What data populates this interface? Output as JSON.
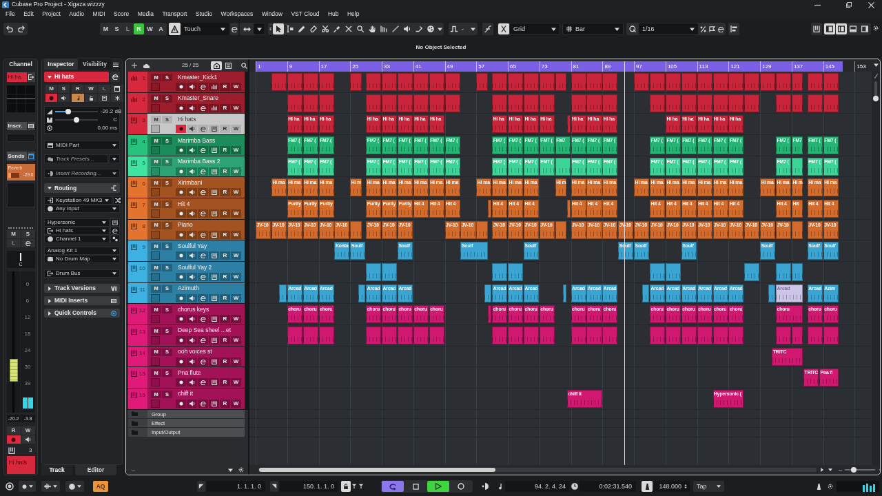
{
  "window": {
    "title": "Cubase Pro Project - Xigaza wizzzy"
  },
  "menu": [
    "File",
    "Edit",
    "Project",
    "Audio",
    "MIDI",
    "Score",
    "Media",
    "Transport",
    "Studio",
    "Workspaces",
    "Window",
    "VST Cloud",
    "Hub",
    "Help"
  ],
  "toolbar": {
    "automation": [
      {
        "label": "M",
        "on": false,
        "disabled": false
      },
      {
        "label": "S",
        "on": false,
        "disabled": false
      },
      {
        "label": "L",
        "on": false,
        "disabled": true
      },
      {
        "label": "R",
        "on": true,
        "disabled": false
      },
      {
        "label": "W",
        "on": false,
        "disabled": false
      },
      {
        "label": "A",
        "on": false,
        "disabled": false
      }
    ],
    "automation_panel": true,
    "automation_mode": "Touch",
    "tools": [
      {
        "kind": "pointer",
        "selected": true
      },
      {
        "kind": "range",
        "selected": false
      },
      {
        "kind": "pencil",
        "selected": false
      },
      {
        "kind": "eraser",
        "selected": false
      },
      {
        "kind": "scissors",
        "selected": false
      },
      {
        "kind": "glue",
        "selected": false
      },
      {
        "kind": "mute",
        "selected": false
      },
      {
        "kind": "zoom",
        "selected": false
      },
      {
        "kind": "hand",
        "selected": false
      },
      {
        "kind": "comp",
        "selected": false
      },
      {
        "kind": "line",
        "selected": false
      },
      {
        "kind": "speaker",
        "selected": false
      },
      {
        "kind": "warp",
        "selected": false
      }
    ],
    "nudge": "-",
    "snap": true,
    "snap_type": "Grid",
    "grid": "Bar",
    "quantize": "1/16",
    "zones": [
      {
        "kind": "left",
        "on": true
      },
      {
        "kind": "split",
        "on": true
      },
      {
        "kind": "lower",
        "on": false
      },
      {
        "kind": "right",
        "on": false
      }
    ]
  },
  "info_line": "No Object Selected",
  "channel": {
    "tab": "Channel",
    "name_tag": "Hi ha.",
    "inserts": "Inser.",
    "sends": "Sends",
    "sends_on": true,
    "send": {
      "name": "Reverb",
      "reading": "-29.0",
      "level": 0.3
    },
    "buttons": [
      {
        "label": "M",
        "disabled": false
      },
      {
        "label": "S",
        "disabled": false
      },
      {
        "label": "L",
        "disabled": true
      }
    ],
    "pan": {
      "reading": "C",
      "level": 0.5
    },
    "scale": [
      "0",
      "6",
      "12",
      "18",
      "24",
      "30",
      "39"
    ],
    "fader": {
      "level": 0.25
    },
    "readings": [
      "-20.2",
      "-3.8"
    ],
    "rw": [
      "R",
      "W"
    ],
    "record": true,
    "number": "3",
    "name": "Hi hats"
  },
  "inspector": {
    "tabs": [
      {
        "label": "Inspector",
        "selected": true
      },
      {
        "label": "Visibility",
        "selected": false
      }
    ],
    "track": {
      "name": "Hi hats",
      "expanded": true
    },
    "buttons": [
      {
        "label": "M",
        "on": false,
        "disabled": false
      },
      {
        "label": "S",
        "on": false,
        "disabled": false
      },
      {
        "label": "R",
        "on": false,
        "disabled": false
      },
      {
        "label": "W",
        "on": false,
        "disabled": false
      },
      {
        "label": "L",
        "on": false,
        "disabled": true
      }
    ],
    "toggles": [
      {
        "kind": "record",
        "on": true
      },
      {
        "kind": "monitor",
        "on": false
      },
      {
        "kind": "note",
        "on": true
      },
      {
        "kind": "lock",
        "on": false
      },
      {
        "kind": "list",
        "on": false
      },
      {
        "kind": "freeze",
        "on": false
      }
    ],
    "volume": {
      "reading": "-20.2 dB",
      "level": 0.28
    },
    "pan": {
      "reading": "C",
      "level": 0.5
    },
    "delay": "0.00 ms",
    "fields": [
      {
        "value": "MIDI Part"
      },
      {
        "placeholder": "Track Presets..."
      },
      {
        "placeholder": "Insert Recording..."
      }
    ],
    "routing": {
      "title": "Routing",
      "expanded": true,
      "groups": [
        [
          {
            "value": "Keystation 49 MK3"
          },
          {
            "value": "Any Input"
          }
        ],
        [
          {
            "value": "Hypersonic"
          },
          {
            "value": "Hi hats"
          },
          {
            "value": "Channel 1"
          }
        ],
        [
          {
            "value": "Analog Kit 1"
          },
          {
            "value": "No Drum Map"
          }
        ],
        [
          {
            "value": "Drum Bus"
          }
        ]
      ]
    },
    "sections": [
      {
        "title": "Track Versions",
        "expanded": false
      },
      {
        "title": "MIDI Inserts",
        "expanded": false
      },
      {
        "title": "Quick Controls",
        "expanded": false
      }
    ]
  },
  "lower_tabs": [
    {
      "label": "Track",
      "selected": true
    },
    {
      "label": "Editor",
      "selected": false
    }
  ],
  "track_list": {
    "count": "25 / 25"
  },
  "arrange": {
    "vertical_zoom": {
      "level": 0.05
    },
    "horizontal_zoom": {
      "level": 0.25
    }
  },
  "ruler": [
    "1",
    "9",
    "17",
    "25",
    "33",
    "41",
    "49",
    "57",
    "65",
    "73",
    "81",
    "89",
    "97",
    "105",
    "113",
    "121",
    "129",
    "137",
    "145",
    "153"
  ],
  "tracks": [
    {
      "number": "1",
      "name": "Kmaster_Kick1",
      "kind": "drum",
      "color": "#d8283e",
      "selected": false,
      "record": false,
      "buttons": [
        "M",
        "S",
        "R",
        "W"
      ],
      "clips": [
        {
          "muted": false
        },
        {
          "muted": false
        },
        {
          "muted": false
        },
        {
          "muted": false
        },
        {
          "muted": false
        },
        {
          "muted": false
        },
        {
          "muted": false
        },
        {
          "muted": false
        },
        {
          "muted": false
        },
        {
          "muted": false
        },
        {
          "muted": false
        },
        {
          "muted": false
        },
        {
          "muted": false
        },
        {
          "muted": false
        },
        {
          "muted": false
        },
        {
          "muted": false
        },
        {
          "muted": false
        },
        {
          "muted": false
        },
        {
          "muted": false
        },
        {
          "muted": false
        },
        {
          "muted": false
        },
        {
          "muted": false
        },
        {
          "muted": false
        },
        {
          "muted": false
        },
        {
          "muted": false
        },
        {
          "muted": false
        },
        {
          "muted": false
        },
        {
          "muted": false
        },
        {
          "muted": false
        },
        {
          "muted": false
        },
        {
          "muted": false
        },
        {
          "muted": false
        },
        {
          "muted": false
        }
      ]
    },
    {
      "number": "2",
      "name": "Kmaster_Snare",
      "kind": "drum",
      "color": "#d8283e",
      "selected": false,
      "record": false,
      "buttons": [
        "M",
        "S",
        "R",
        "W"
      ],
      "clips": [
        {
          "muted": false
        },
        {
          "muted": false
        },
        {
          "muted": false
        },
        {
          "muted": false
        },
        {
          "muted": false
        },
        {
          "muted": false
        },
        {
          "muted": false
        },
        {
          "muted": false
        },
        {
          "muted": false
        },
        {
          "muted": false
        },
        {
          "muted": false
        },
        {
          "muted": false
        },
        {
          "muted": false
        },
        {
          "muted": false
        },
        {
          "muted": false
        },
        {
          "muted": false
        },
        {
          "muted": false
        },
        {
          "muted": false
        },
        {
          "muted": false
        },
        {
          "muted": false
        },
        {
          "muted": false
        },
        {
          "muted": false
        },
        {
          "muted": false
        },
        {
          "muted": false
        },
        {
          "muted": false
        },
        {
          "muted": false
        },
        {
          "muted": false
        }
      ]
    },
    {
      "number": "3",
      "name": "Hi hats",
      "kind": "instrument",
      "color": "#d8283e",
      "selected": true,
      "record": true,
      "buttons": [
        "M",
        "S",
        "R",
        "W"
      ],
      "clips": [
        {
          "label": "Hi ha",
          "muted": false
        },
        {
          "label": "Hi ha",
          "muted": false
        },
        {
          "label": "Hi ha",
          "muted": false
        },
        {
          "label": "Hi ha",
          "muted": false
        },
        {
          "label": "Hi ha",
          "muted": false
        },
        {
          "label": "Hi ha",
          "muted": false
        },
        {
          "label": "Hi ha",
          "muted": false
        },
        {
          "label": "Hi ha",
          "muted": false
        },
        {
          "label": "Hi ha",
          "muted": false
        },
        {
          "label": "Hi ha",
          "muted": false
        },
        {
          "label": "Hi ha",
          "muted": false
        },
        {
          "label": "Hi ha",
          "muted": false
        },
        {
          "muted": false
        },
        {
          "label": "Hi ha",
          "muted": false
        },
        {
          "label": "Hi ha",
          "muted": false
        },
        {
          "label": "Hi ha",
          "muted": false
        },
        {
          "label": "Hi ha",
          "muted": false
        },
        {
          "label": "Hi ha",
          "muted": false
        },
        {
          "label": "Hi ha",
          "muted": false
        },
        {
          "label": "Hi ha",
          "muted": false
        },
        {
          "label": "Hi ha",
          "muted": false
        }
      ]
    },
    {
      "number": "4",
      "name": "Marimba Bass",
      "kind": "instrument",
      "color": "#27c27d",
      "selected": false,
      "record": false,
      "buttons": [
        "M",
        "S",
        "R",
        "W"
      ],
      "clips": [
        {
          "label": "FM7 (",
          "muted": false
        },
        {
          "label": "FM7 (",
          "muted": false
        },
        {
          "label": "FM7 (",
          "muted": false
        },
        {
          "label": "FM7 (",
          "muted": false
        },
        {
          "label": "FM7 (",
          "muted": false
        },
        {
          "label": "FM7 (",
          "muted": false
        },
        {
          "label": "FM7 (",
          "muted": false
        },
        {
          "label": "FM7 (",
          "muted": false
        },
        {
          "label": "FM7 (",
          "muted": false
        },
        {
          "label": "FM7 (",
          "muted": false
        },
        {
          "label": "FM7 (",
          "muted": false
        },
        {
          "label": "FM7 (",
          "muted": false
        },
        {
          "label": "FM7 (",
          "muted": false
        },
        {
          "label": "FM7",
          "muted": false
        },
        {
          "label": "FM7 (",
          "muted": false
        },
        {
          "label": "FM7 (",
          "muted": false
        },
        {
          "label": "FM7 (",
          "muted": false
        },
        {
          "label": "FM7 (",
          "muted": false
        },
        {
          "label": "FM7 (",
          "muted": false
        },
        {
          "label": "FM7 (",
          "muted": false
        },
        {
          "label": "FM7 (",
          "muted": false
        },
        {
          "label": "FM7 (",
          "muted": false
        },
        {
          "label": "FM7 (",
          "muted": false
        },
        {
          "label": "FM7 (",
          "muted": false
        },
        {
          "label": "FM7",
          "muted": false
        },
        {
          "label": "FM7 (",
          "muted": false
        },
        {
          "label": "FM7 (",
          "muted": false
        }
      ]
    },
    {
      "number": "5",
      "name": "Marimba Bass 2",
      "kind": "instrument",
      "color": "#3fe3a2",
      "selected": false,
      "record": false,
      "buttons": [
        "M",
        "S",
        "R",
        "W"
      ],
      "clips": [
        {
          "label": "FM7 (",
          "muted": false
        },
        {
          "label": "FM7 (",
          "muted": false
        },
        {
          "label": "FM7 (",
          "muted": false
        },
        {
          "label": "FM7 (",
          "muted": false
        },
        {
          "label": "FM7 (",
          "muted": false
        },
        {
          "label": "FM7 (",
          "muted": false
        },
        {
          "label": "FM7 (",
          "muted": false
        },
        {
          "label": "FM7 (",
          "muted": false
        },
        {
          "label": "FM7 (",
          "muted": false
        },
        {
          "label": "FM7 (",
          "muted": false
        },
        {
          "label": "FM7 (",
          "muted": false
        },
        {
          "label": "FM7 (",
          "muted": false
        },
        {
          "label": "FM7 (",
          "muted": false
        },
        {
          "muted": false
        },
        {
          "label": "FM7 (",
          "muted": false
        },
        {
          "label": "FM7 (",
          "muted": false
        },
        {
          "label": "FM7 (",
          "muted": false
        },
        {
          "label": "FM7 (",
          "muted": false
        },
        {
          "label": "FM7 (",
          "muted": false
        },
        {
          "label": "FM7 (",
          "muted": false
        },
        {
          "label": "FM7 (",
          "muted": false
        },
        {
          "label": "FM7 (",
          "muted": false
        },
        {
          "label": "FM7 (",
          "muted": false
        },
        {
          "label": "FM7 (",
          "muted": false
        },
        {
          "muted": false
        },
        {
          "label": "FM7 (",
          "muted": false
        },
        {
          "label": "FM7 (",
          "muted": false
        }
      ]
    },
    {
      "number": "6",
      "name": "Xirimbani",
      "kind": "instrument",
      "color": "#e3732f",
      "selected": false,
      "record": false,
      "buttons": [
        "M",
        "S",
        "R",
        "W"
      ],
      "clips": [
        {
          "label": "Hi ma",
          "muted": false
        },
        {
          "label": "Hi ma",
          "muted": false
        },
        {
          "label": "Hi ma",
          "muted": false
        },
        {
          "label": "Hi ma",
          "muted": false
        },
        {
          "label": "Hi m",
          "muted": false
        },
        {
          "label": "Hi ma",
          "muted": false
        },
        {
          "label": "Hi ma",
          "muted": false
        },
        {
          "label": "Hi ma",
          "muted": false
        },
        {
          "label": "Hi ma",
          "muted": false
        },
        {
          "label": "Hi ma",
          "muted": false
        },
        {
          "label": "Hi ma",
          "muted": false
        },
        {
          "label": "Hi ma",
          "muted": false
        },
        {
          "label": "Hi ma",
          "muted": false
        },
        {
          "label": "Hi ma",
          "muted": false
        },
        {
          "label": "Hi ma",
          "muted": false
        },
        {
          "label": "Hi m",
          "muted": false
        },
        {
          "label": "Hi ma",
          "muted": false
        },
        {
          "label": "Hi ma",
          "muted": false
        },
        {
          "label": "Hi ma",
          "muted": false
        },
        {
          "label": "Hi ma",
          "muted": false
        },
        {
          "label": "Hi ma",
          "muted": false
        },
        {
          "label": "Hi ma",
          "muted": false
        },
        {
          "label": "Hi ma",
          "muted": false
        },
        {
          "label": "Hi ma",
          "muted": false
        },
        {
          "label": "Hi ma",
          "muted": false
        },
        {
          "label": "Hi ma",
          "muted": false
        },
        {
          "label": "Hi ma",
          "muted": false
        },
        {
          "label": "Hi ma",
          "muted": false
        },
        {
          "label": "Hi m",
          "muted": false
        },
        {
          "label": "Hi ma",
          "muted": false
        },
        {
          "label": "Hi ma",
          "muted": false
        }
      ]
    },
    {
      "number": "7",
      "name": "Hit 4",
      "kind": "instrument",
      "color": "#e3732f",
      "selected": false,
      "record": false,
      "buttons": [
        "M",
        "S",
        "R",
        "W"
      ],
      "clips": [
        {
          "label": "Purity",
          "muted": false
        },
        {
          "label": "Purity",
          "muted": false
        },
        {
          "label": "Purity",
          "muted": false
        },
        {
          "label": "Purity",
          "muted": false
        },
        {
          "label": "Purity",
          "muted": false
        },
        {
          "label": "Purity",
          "muted": false
        },
        {
          "label": "Hit 4",
          "muted": false
        },
        {
          "label": "Hit 4",
          "muted": false
        },
        {
          "label": "Hit 4",
          "muted": false
        },
        {
          "muted": false
        },
        {
          "label": "Hit 4",
          "muted": false
        },
        {
          "label": "Hit 4",
          "muted": false
        },
        {
          "label": "Hit 4",
          "muted": false
        },
        {
          "muted": false
        },
        {
          "label": "Hit 4",
          "muted": false
        },
        {
          "label": "Hit 4",
          "muted": false
        },
        {
          "label": "Hit 4",
          "muted": false
        },
        {
          "label": "Hit 4",
          "muted": false
        },
        {
          "label": "Hit 4",
          "muted": false
        },
        {
          "label": "Hit 4",
          "muted": false
        },
        {
          "label": "Hit 4",
          "muted": false
        },
        {
          "label": "Hit 4",
          "muted": false
        },
        {
          "label": "Hit 4",
          "muted": false
        },
        {
          "label": "Hit 4",
          "muted": false
        },
        {
          "label": "Hit",
          "muted": false
        },
        {
          "label": "Hit 4",
          "muted": false
        },
        {
          "label": "Hit 4",
          "muted": false
        }
      ]
    },
    {
      "number": "8",
      "name": "Piano",
      "kind": "instrument",
      "color": "#e3732f",
      "selected": false,
      "record": false,
      "buttons": [
        "M",
        "S",
        "R",
        "W"
      ],
      "clips": [
        {
          "label": "JV-10",
          "muted": false
        },
        {
          "label": "JV-10",
          "muted": false
        },
        {
          "label": "JV-10",
          "muted": false
        },
        {
          "label": "JV-10",
          "muted": false
        },
        {
          "label": "JV-10",
          "muted": false
        },
        {
          "label": "JV-10",
          "muted": false
        },
        {
          "muted": false
        },
        {
          "label": "JV-10",
          "muted": false
        },
        {
          "label": "JV-10",
          "muted": false
        },
        {
          "label": "JV-10",
          "muted": false
        },
        {
          "label": "JV-10",
          "muted": false
        },
        {
          "label": "JV-10",
          "muted": false
        },
        {
          "muted": false
        },
        {
          "label": "JV-10",
          "muted": false
        },
        {
          "label": "JV-10",
          "muted": false
        },
        {
          "label": "JV-10",
          "muted": false
        },
        {
          "label": "JV-10",
          "muted": false
        },
        {
          "muted": false
        },
        {
          "label": "JV-10",
          "muted": false
        },
        {
          "label": "JV-10",
          "muted": false
        },
        {
          "label": "JV-10",
          "muted": false
        },
        {
          "label": "JV-10",
          "muted": false
        },
        {
          "label": "JV-10",
          "muted": false
        },
        {
          "label": "JV-10",
          "muted": false
        },
        {
          "label": "JV-10",
          "muted": false
        },
        {
          "label": "JV-10",
          "muted": false
        },
        {
          "label": "JV-10",
          "muted": false
        },
        {
          "label": "JV-10",
          "muted": false
        },
        {
          "label": "JV-10",
          "muted": false
        },
        {
          "label": "JV-10",
          "muted": false
        },
        {
          "label": "JV-10",
          "muted": false
        },
        {
          "label": "JV-10",
          "muted": false
        },
        {
          "muted": false
        },
        {
          "label": "JV-10",
          "muted": false
        },
        {
          "label": "JV-10",
          "muted": false
        }
      ]
    },
    {
      "number": "9",
      "name": "Soulful Yay",
      "kind": "instrument",
      "color": "#3eb1e3",
      "selected": false,
      "record": false,
      "buttons": [
        "M",
        "S",
        "R",
        "W"
      ],
      "clips": [
        {
          "label": "Konta",
          "muted": false
        },
        {
          "label": "Soulf",
          "muted": false
        },
        {
          "label": "Soulf",
          "muted": false
        },
        {
          "label": "Soulf",
          "muted": false
        },
        {
          "label": "Soulf",
          "muted": false
        },
        {
          "label": "Soulf",
          "muted": false
        },
        {
          "label": "Soulf",
          "muted": false
        },
        {
          "label": "Soulf",
          "muted": false
        },
        {
          "label": "Soulf",
          "muted": false
        },
        {
          "label": "Soulf",
          "muted": false
        },
        {
          "label": "Soulf",
          "muted": false
        }
      ]
    },
    {
      "number": "10",
      "name": "Soulful Yay 2",
      "kind": "instrument",
      "color": "#3eb1e3",
      "selected": false,
      "record": false,
      "buttons": [
        "M",
        "S",
        "R",
        "W"
      ],
      "clips": [
        {
          "muted": false
        },
        {
          "muted": false
        },
        {
          "muted": false
        },
        {
          "muted": false
        },
        {
          "muted": false
        },
        {
          "muted": false
        },
        {
          "muted": false
        },
        {
          "muted": false
        },
        {
          "muted": false
        }
      ]
    },
    {
      "number": "11",
      "name": "Azimuth",
      "kind": "instrument",
      "color": "#3eb1e3",
      "selected": false,
      "record": false,
      "buttons": [
        "M",
        "S",
        "R",
        "W"
      ],
      "clips": [
        {
          "muted": false
        },
        {
          "label": "Arcad",
          "muted": false
        },
        {
          "label": "Arcad",
          "muted": false
        },
        {
          "label": "Arcad",
          "muted": false
        },
        {
          "muted": false
        },
        {
          "label": "Arcad",
          "muted": false
        },
        {
          "label": "Arcad",
          "muted": false
        },
        {
          "label": "Arcad",
          "muted": false
        },
        {
          "muted": false
        },
        {
          "label": "Arcad",
          "muted": false
        },
        {
          "label": "Arcad",
          "muted": false
        },
        {
          "label": "Arcad",
          "muted": false
        },
        {
          "muted": false
        },
        {
          "label": "Arcad",
          "muted": false
        },
        {
          "label": "Arcad",
          "muted": false
        },
        {
          "label": "Arcad",
          "muted": false
        },
        {
          "muted": false
        },
        {
          "label": "Arcad",
          "muted": false
        },
        {
          "label": "Arcad",
          "muted": false
        },
        {
          "label": "Arcad",
          "muted": false
        },
        {
          "label": "Arcad",
          "muted": false
        },
        {
          "label": "Arcad",
          "muted": false
        },
        {
          "label": "Arcad",
          "muted": false
        },
        {
          "muted": false
        },
        {
          "label": "Arcad",
          "muted": true
        },
        {
          "label": "Arcad",
          "muted": false
        },
        {
          "label": "Azim",
          "muted": false
        }
      ]
    },
    {
      "number": "12",
      "name": "chorus keys",
      "kind": "instrument",
      "color": "#e01a78",
      "selected": false,
      "record": false,
      "buttons": [
        "M",
        "S",
        "R",
        "W"
      ],
      "clips": [
        {
          "label": "choru",
          "muted": false
        },
        {
          "label": "choru",
          "muted": false
        },
        {
          "label": "choru",
          "muted": false
        },
        {
          "label": "choru",
          "muted": false
        },
        {
          "label": "choru",
          "muted": false
        },
        {
          "label": "choru",
          "muted": false
        },
        {
          "label": "choru",
          "muted": false
        },
        {
          "label": "choru",
          "muted": false
        },
        {
          "muted": false
        },
        {
          "label": "choru",
          "muted": false
        },
        {
          "label": "choru",
          "muted": false
        },
        {
          "label": "choru",
          "muted": false
        },
        {
          "label": "choru",
          "muted": false
        },
        {
          "label": "choru",
          "muted": false
        },
        {
          "label": "choru",
          "muted": false
        },
        {
          "label": "choru",
          "muted": false
        },
        {
          "label": "choru",
          "muted": false
        },
        {
          "label": "choru",
          "muted": false
        },
        {
          "label": "choru",
          "muted": false
        },
        {
          "label": "choru",
          "muted": false
        },
        {
          "label": "choru",
          "muted": false
        },
        {
          "label": "choru",
          "muted": false
        },
        {
          "label": "choru",
          "muted": false
        },
        {
          "label": "choru",
          "muted": false
        },
        {
          "label": "choru",
          "muted": false
        }
      ]
    },
    {
      "number": "13",
      "name": "Deep Sea sheel ...et",
      "kind": "instrument",
      "color": "#e01a78",
      "selected": false,
      "record": false,
      "buttons": [
        "M",
        "S",
        "R",
        "W"
      ],
      "clips": [
        {
          "muted": false
        },
        {
          "muted": false
        },
        {
          "muted": false
        },
        {
          "muted": false
        },
        {
          "muted": false
        },
        {
          "muted": false
        },
        {
          "muted": false
        },
        {
          "muted": false
        },
        {
          "muted": false
        },
        {
          "muted": false
        },
        {
          "muted": false
        },
        {
          "muted": false
        },
        {
          "muted": false
        },
        {
          "muted": false
        },
        {
          "muted": false
        },
        {
          "muted": false
        },
        {
          "muted": false
        },
        {
          "muted": false
        },
        {
          "muted": false
        },
        {
          "muted": false
        },
        {
          "muted": false
        },
        {
          "muted": false
        },
        {
          "muted": false
        },
        {
          "muted": false
        },
        {
          "muted": false
        }
      ]
    },
    {
      "number": "14",
      "name": "ooh voices st",
      "kind": "instrument",
      "color": "#e01a78",
      "selected": false,
      "record": false,
      "buttons": [
        "M",
        "S",
        "R",
        "W"
      ],
      "clips": [
        {
          "label": "TRITC",
          "muted": false
        }
      ]
    },
    {
      "number": "15",
      "name": "Pna flute",
      "kind": "instrument",
      "color": "#e01a78",
      "selected": false,
      "record": false,
      "buttons": [
        "M",
        "S",
        "R",
        "W"
      ],
      "clips": [
        {
          "label": "TRITC",
          "muted": false
        },
        {
          "label": "Pna fl",
          "muted": false
        }
      ]
    },
    {
      "number": "16",
      "name": "chiff it",
      "kind": "instrument",
      "color": "#e01a78",
      "selected": false,
      "record": false,
      "buttons": [
        "M",
        "S",
        "R",
        "W"
      ],
      "clips": [
        {
          "label": "chiff it",
          "muted": false
        },
        {
          "label": "Hypersonic (",
          "muted": false
        }
      ]
    }
  ],
  "folders": [
    {
      "name": "Group"
    },
    {
      "name": "Effect"
    },
    {
      "name": "Input/Output"
    }
  ],
  "transport": {
    "auto_quantize": {
      "label": "AQ",
      "on": true
    },
    "left_locator": "1. 1. 1. 0",
    "right_locator": "150. 1. 1. 0",
    "lock": true,
    "cycle": true,
    "playing": true,
    "recording": false,
    "position": "94. 2. 4. 24",
    "time": "0:02:31.540",
    "tempo_track": true,
    "tempo": "148.000",
    "tap": "Tap"
  }
}
